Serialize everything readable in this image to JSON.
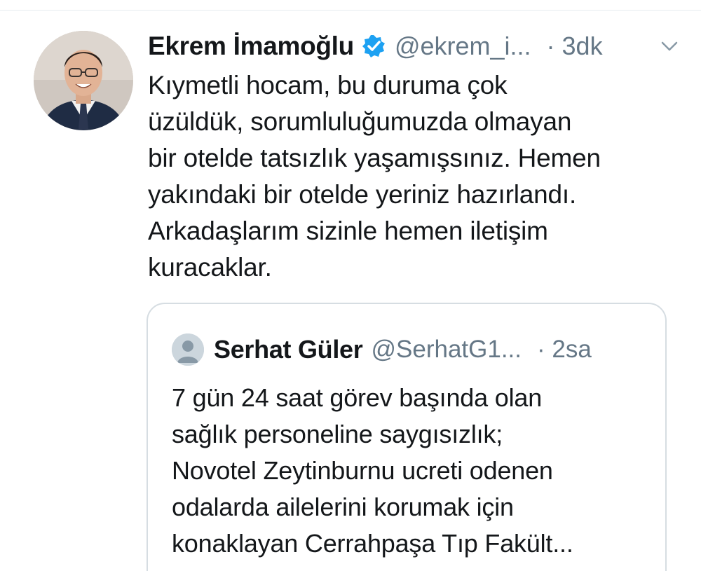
{
  "tweet": {
    "author_name": "Ekrem İmamoğlu",
    "handle": "@ekrem_i...",
    "time": "· 3dk",
    "text": "Kıymetli hocam, bu duruma çok\nüzüldük, sorumluluğumuzda olmayan\nbir otelde tatsızlık yaşamışsınız. Hemen\nyakındaki bir otelde yeriniz hazırlandı.\nArkadaşlarım sizinle hemen iletişim\nkuracaklar.",
    "verified_icon": "verified-badge-icon",
    "menu_icon": "chevron-down-icon"
  },
  "quoted_tweet": {
    "author_name": "Serhat Güler",
    "handle": "@SerhatG1...",
    "time": "· 2sa",
    "text": "7 gün 24 saat görev başında olan\nsağlık personeline saygısızlık;\nNovotel Zeytinburnu ucreti odenen\nodalarda ailelerini korumak için\nkonaklayan Cerrahpaşa Tıp Fakült...",
    "avatar_icon": "default-avatar-icon"
  },
  "colors": {
    "text": "#14171a",
    "secondary": "#657786",
    "verified": "#1da1f2",
    "border": "#d6dde2"
  }
}
